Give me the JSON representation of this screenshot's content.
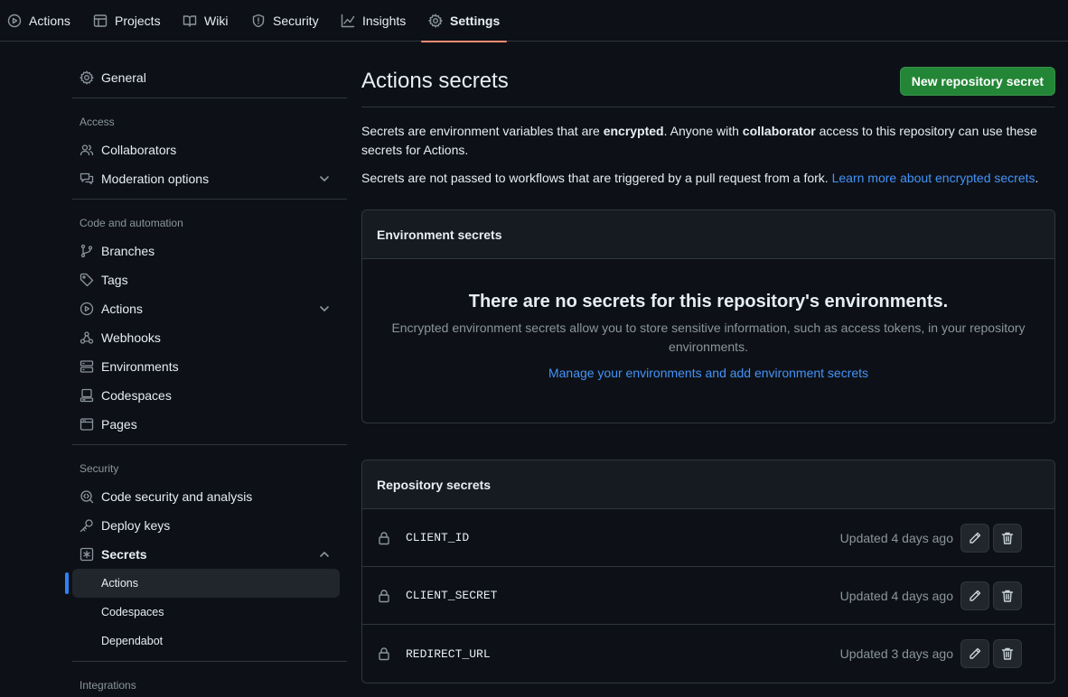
{
  "topnav": {
    "tabs": [
      {
        "label": "Actions",
        "icon": "play-icon"
      },
      {
        "label": "Projects",
        "icon": "table-icon"
      },
      {
        "label": "Wiki",
        "icon": "book-icon"
      },
      {
        "label": "Security",
        "icon": "shield-icon"
      },
      {
        "label": "Insights",
        "icon": "graph-icon"
      },
      {
        "label": "Settings",
        "icon": "gear-icon",
        "selected": true
      }
    ]
  },
  "sidebar": {
    "general": "General",
    "access_heading": "Access",
    "collaborators": "Collaborators",
    "moderation": "Moderation options",
    "code_heading": "Code and automation",
    "branches": "Branches",
    "tags": "Tags",
    "actions": "Actions",
    "webhooks": "Webhooks",
    "environments": "Environments",
    "codespaces": "Codespaces",
    "pages": "Pages",
    "security_heading": "Security",
    "code_security": "Code security and analysis",
    "deploy_keys": "Deploy keys",
    "secrets": "Secrets",
    "secrets_actions": "Actions",
    "secrets_codespaces": "Codespaces",
    "secrets_dependabot": "Dependabot",
    "integrations_heading": "Integrations"
  },
  "main": {
    "title": "Actions secrets",
    "new_button": "New repository secret",
    "intro_1a": "Secrets are environment variables that are ",
    "intro_1b": "encrypted",
    "intro_1c": ". Anyone with ",
    "intro_1d": "collaborator",
    "intro_1e": " access to this repository can use these secrets for Actions.",
    "intro_2a": "Secrets are not passed to workflows that are triggered by a pull request from a fork. ",
    "intro_2_link": "Learn more about encrypted secrets",
    "intro_2b": ".",
    "env_box": {
      "header": "Environment secrets",
      "empty_title": "There are no secrets for this repository's environments.",
      "empty_desc": "Encrypted environment secrets allow you to store sensitive information, such as access tokens, in your repository environments.",
      "manage_link": "Manage your environments and add environment secrets"
    },
    "repo_box": {
      "header": "Repository secrets",
      "rows": [
        {
          "name": "CLIENT_ID",
          "updated": "Updated 4 days ago"
        },
        {
          "name": "CLIENT_SECRET",
          "updated": "Updated 4 days ago"
        },
        {
          "name": "REDIRECT_URL",
          "updated": "Updated 3 days ago"
        }
      ]
    }
  },
  "colors": {
    "background": "#0d1117",
    "accent_link": "#4493f8",
    "primary_button": "#238636",
    "selected_tab_underline": "#fd8c73",
    "active_indicator": "#2f81f7"
  }
}
